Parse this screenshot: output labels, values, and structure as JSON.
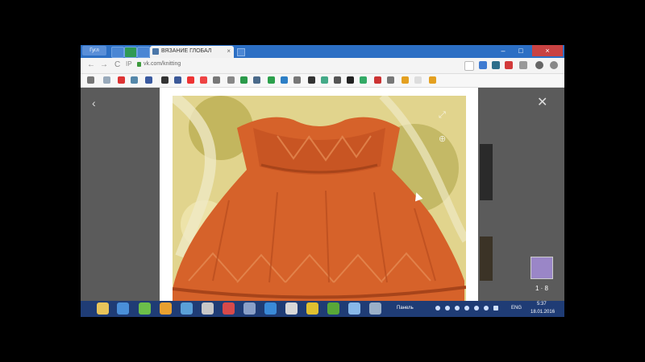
{
  "browser": {
    "tab_title": "ВЯЗАНИЕ ГЛОБАЛ",
    "tab_close": "×",
    "pinned_label": "Гугл",
    "url": "vk.com/knitting",
    "back": "←",
    "forward": "→",
    "reload": "C",
    "win_min": "–",
    "win_max": "□",
    "win_close": "×"
  },
  "viewer": {
    "prev_arrow": "‹",
    "close": "✕",
    "counter": "1 · 8"
  },
  "taskbar": {
    "lang_label": "Панель",
    "lang": "ENG",
    "time": "5:37",
    "date": "18.01.2016"
  },
  "colors": {
    "tab_strip": "#2c6fc4",
    "taskbar": "#1f3c75",
    "viewer_bg": "#5b5b5b",
    "dress": "#d6622a"
  }
}
